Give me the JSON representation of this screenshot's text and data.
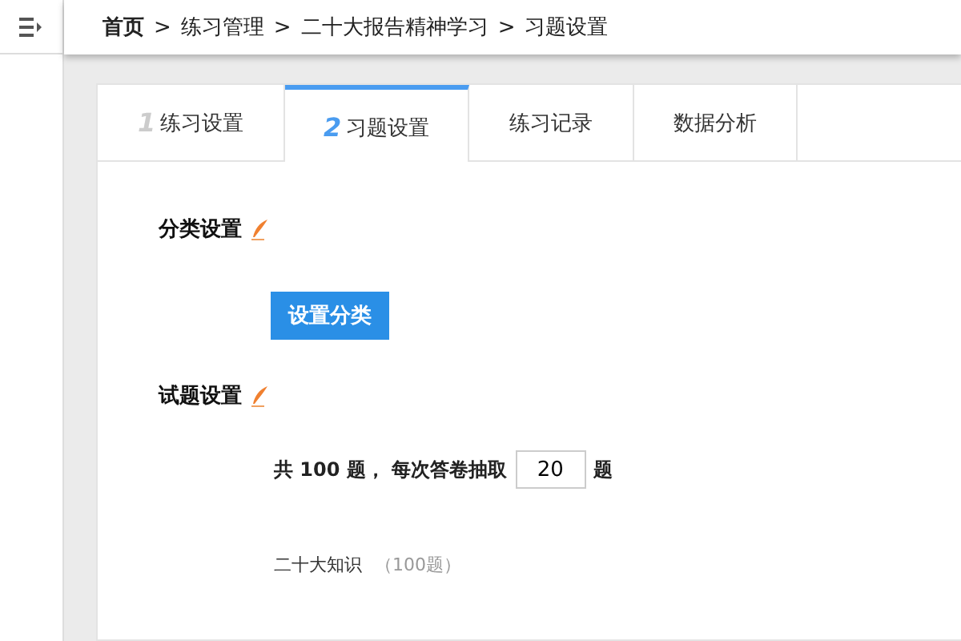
{
  "breadcrumb": {
    "items": [
      "首页",
      "练习管理",
      "二十大报告精神学习",
      "习题设置"
    ],
    "separator": ">"
  },
  "tabs": [
    {
      "number": "1",
      "label": "练习设置",
      "selected": false
    },
    {
      "number": "2",
      "label": "习题设置",
      "selected": true
    },
    {
      "label": "练习记录",
      "selected": false
    },
    {
      "label": "数据分析",
      "selected": false
    }
  ],
  "category_section": {
    "title": "分类设置",
    "button": "设置分类"
  },
  "question_section": {
    "title": "试题设置",
    "quota": {
      "prefix": "共 100 题， 每次答卷抽取",
      "value": "20",
      "suffix": "题"
    },
    "categories": [
      {
        "name": "二十大知识",
        "count": "（100题）"
      }
    ]
  }
}
